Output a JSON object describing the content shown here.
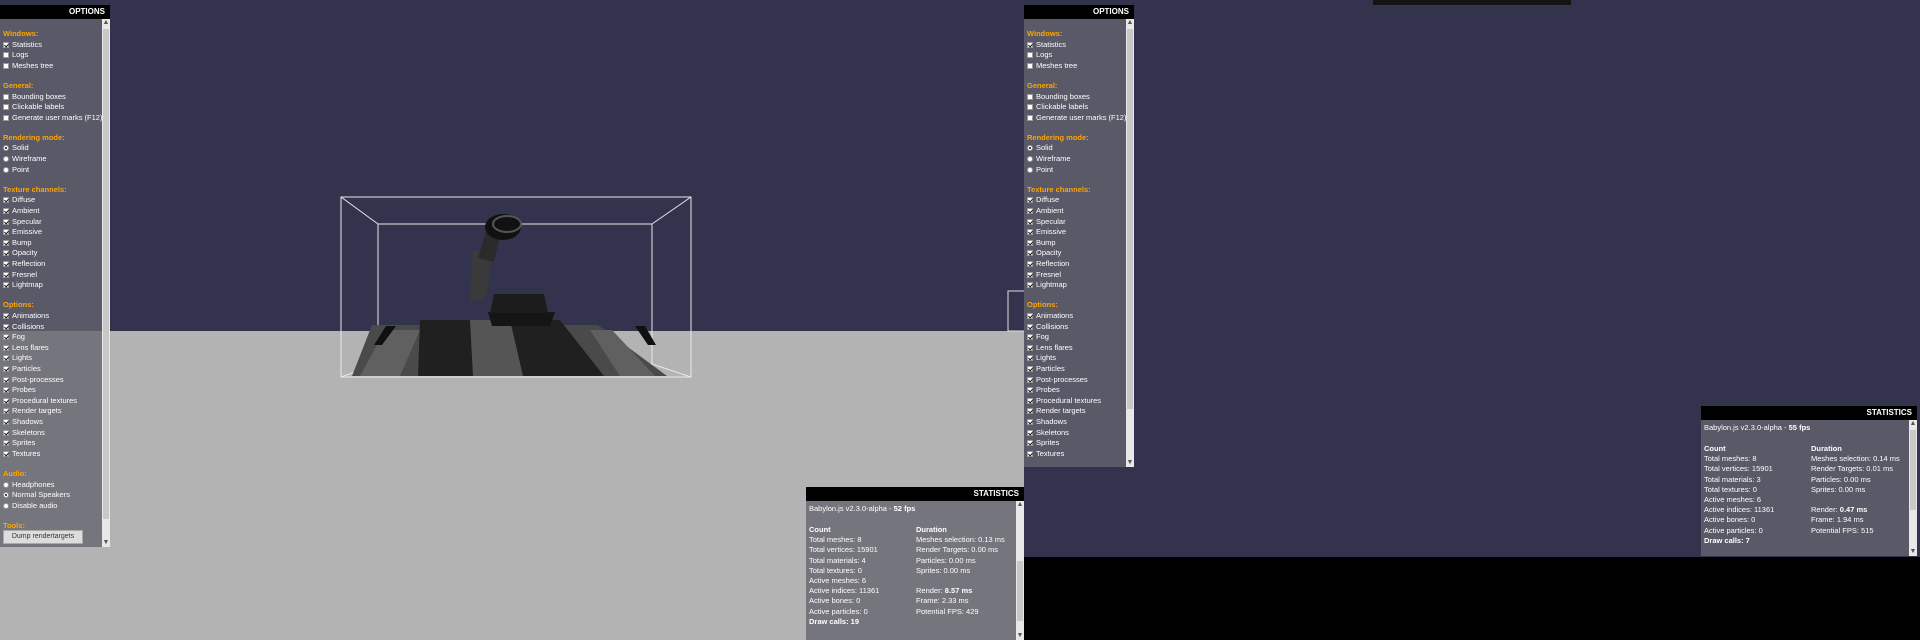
{
  "options_panel": {
    "title": "OPTIONS",
    "sections": {
      "windows": "Windows:",
      "general": "General:",
      "rendering": "Rendering mode:",
      "texture": "Texture channels:",
      "options": "Options:",
      "audio": "Audio:",
      "tools": "Tools:"
    },
    "windows": [
      "Statistics",
      "Logs",
      "Meshes tree"
    ],
    "general": [
      "Bounding boxes",
      "Clickable labels",
      "Generate user marks (F12)"
    ],
    "rendering": [
      "Solid",
      "Wireframe",
      "Point"
    ],
    "texture": [
      "Diffuse",
      "Ambient",
      "Specular",
      "Emissive",
      "Bump",
      "Opacity",
      "Reflection",
      "Fresnel",
      "Lightmap"
    ],
    "options": [
      "Animations",
      "Collisions",
      "Fog",
      "Lens flares",
      "Lights",
      "Particles",
      "Post-processes",
      "Probes",
      "Procedural textures",
      "Render targets",
      "Shadows",
      "Skeletons",
      "Sprites",
      "Textures"
    ],
    "audio": [
      "Headphones",
      "Normal Speakers",
      "Disable audio"
    ],
    "dump_button": "Dump rendertargets"
  },
  "stats_left": {
    "title": "STATISTICS",
    "version": "Babylon.js v2.3.0-alpha - ",
    "fps": "52 fps",
    "count_head": "Count",
    "duration_head": "Duration",
    "total_meshes": "Total meshes: 8",
    "total_vertices": "Total vertices: 15901",
    "total_materials": "Total materials: 4",
    "total_textures": "Total textures: 0",
    "active_meshes": "Active meshes: 6",
    "active_indices": "Active indices: 11361",
    "active_bones": "Active bones: 0",
    "active_particles": "Active particles: 0",
    "draw_calls": "Draw calls: 19",
    "meshes_selection": "Meshes selection: 0.13 ms",
    "render_targets": "Render Targets: 0.00 ms",
    "particles": "Particles: 0.00 ms",
    "sprites": "Sprites: 0.00 ms",
    "render_label": "Render: ",
    "render_value": "8.57 ms",
    "frame": "Frame: 2.33 ms",
    "potential_fps": "Potential FPS: 429"
  },
  "stats_right": {
    "title": "STATISTICS",
    "version": "Babylon.js v2.3.0-alpha - ",
    "fps": "55 fps",
    "count_head": "Count",
    "duration_head": "Duration",
    "total_meshes": "Total meshes: 8",
    "total_vertices": "Total vertices: 15901",
    "total_materials": "Total materials: 3",
    "total_textures": "Total textures: 0",
    "active_meshes": "Active meshes: 6",
    "active_indices": "Active indices: 11361",
    "active_bones": "Active bones: 0",
    "active_particles": "Active particles: 0",
    "draw_calls": "Draw calls: 7",
    "meshes_selection": "Meshes selection: 0.14 ms",
    "render_targets": "Render Targets: 0.01 ms",
    "particles": "Particles: 0.00 ms",
    "sprites": "Sprites: 0.00 ms",
    "render_label": "Render: ",
    "render_value": "0.47 ms",
    "frame": "Frame: 1.94 ms",
    "potential_fps": "Potential FPS: 515"
  },
  "colors": {
    "sky": "#33334d",
    "floor": "#b3b3b3",
    "section_header": "#ffa500"
  }
}
